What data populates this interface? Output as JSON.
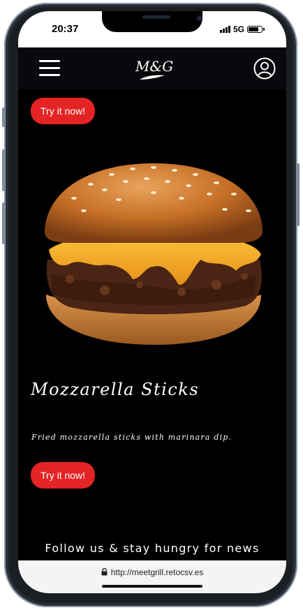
{
  "status_bar": {
    "time": "20:37",
    "network": "5G"
  },
  "navbar": {
    "menu_icon": "hamburger-menu-icon",
    "logo_text": "M&G",
    "account_icon": "user-circle-icon"
  },
  "hero": {
    "try_button_label": "Try it now!",
    "image": "burger-image"
  },
  "product": {
    "title": "Mozzarella Sticks",
    "description": "Fried mozzarella sticks with marinara dip.",
    "try_button_label": "Try it now!"
  },
  "footer": {
    "follow_text": "Follow us & stay hungry for news"
  },
  "browser": {
    "url": "http://meetgrill.retocsv.es",
    "lock_icon": "lock-icon"
  },
  "colors": {
    "accent": "#e42424",
    "background": "#000000",
    "navbar": "#07090c"
  }
}
